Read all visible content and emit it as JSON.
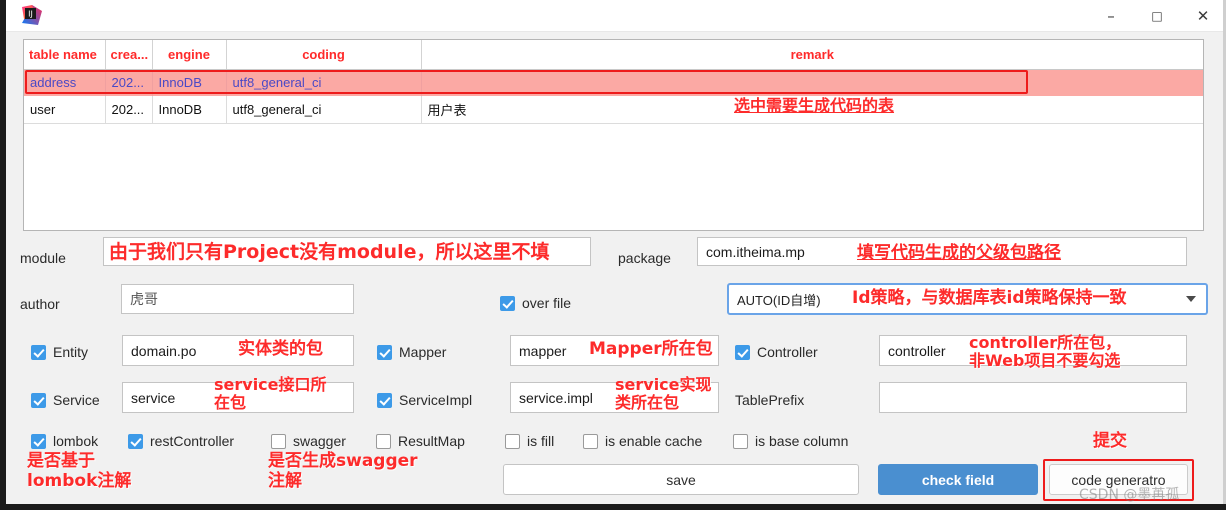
{
  "window": {
    "icon": "intellij-idea-logo",
    "minimize": "–",
    "maximize": "□",
    "close": "✕"
  },
  "table": {
    "headers": [
      "table name",
      "crea...",
      "engine",
      "coding",
      "remark"
    ],
    "rows": [
      {
        "name": "address",
        "created": "202...",
        "engine": "InnoDB",
        "coding": "utf8_general_ci",
        "remark": "",
        "selected": true
      },
      {
        "name": "user",
        "created": "202...",
        "engine": "InnoDB",
        "coding": "utf8_general_ci",
        "remark": "用户表",
        "selected": false
      }
    ]
  },
  "form": {
    "module_label": "module",
    "module_value": "",
    "package_label": "package",
    "package_value": "com.itheima.mp",
    "author_label": "author",
    "author_value": "虎哥",
    "over_file_label": "over file",
    "over_file_checked": true,
    "id_strategy_value": "AUTO(ID自增)",
    "entity_label": "Entity",
    "entity_checked": true,
    "entity_value": "domain.po",
    "mapper_label": "Mapper",
    "mapper_checked": true,
    "mapper_value": "mapper",
    "controller_label": "Controller",
    "controller_checked": true,
    "controller_value": "controller",
    "service_label": "Service",
    "service_checked": true,
    "service_value": "service",
    "serviceimpl_label": "ServiceImpl",
    "serviceimpl_checked": true,
    "serviceimpl_value": "service.impl",
    "tableprefix_label": "TablePrefix",
    "tableprefix_value": ""
  },
  "options": {
    "lombok": "lombok",
    "restController": "restController",
    "swagger": "swagger",
    "resultMap": "ResultMap",
    "isFill": "is fill",
    "isEnableCache": "is enable cache",
    "isBaseColumn": "is base column"
  },
  "buttons": {
    "save": "save",
    "check_field": "check field",
    "code_generator": "code generatro"
  },
  "annotations": {
    "select_table": "选中需要生成代码的表",
    "module_note": "由于我们只有Project没有module，所以这里不填",
    "package_note": "填写代码生成的父级包路径",
    "id_note": "Id策略，与数据库表id策略保持一致",
    "entity_note": "实体类的包",
    "mapper_note": "Mapper所在包",
    "controller_note_l1": "controller所在包，",
    "controller_note_l2": "非Web项目不要勾选",
    "service_note_l1": "service接口所",
    "service_note_l2": "在包",
    "serviceimpl_note_l1": "service实现",
    "serviceimpl_note_l2": "类所在包",
    "lombok_note_l1": "是否基于",
    "lombok_note_l2": "lombok注解",
    "swagger_note_l1": "是否生成swagger",
    "swagger_note_l2": "注解",
    "submit_note": "提交"
  },
  "watermark": "CSDN @墨苒孤",
  "colors": {
    "annotation_red": "#fd2b2b",
    "selected_row": "#fba9a4",
    "checkbox_blue": "#3d9ae8",
    "primary_button": "#4a8fd0",
    "combo_border": "#6aa4e8"
  }
}
